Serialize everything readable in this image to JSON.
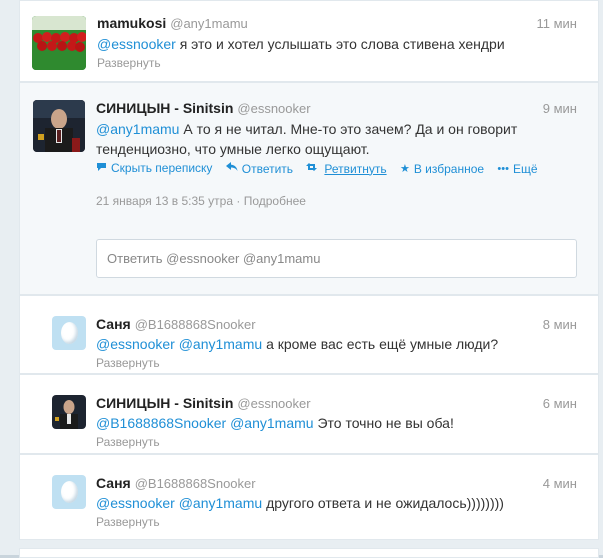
{
  "tweets": [
    {
      "fullname": "mamukosi",
      "username": "@any1mamu",
      "time": "11 мин",
      "mentions": [
        "@essnooker"
      ],
      "text": "я это и хотел услышать это слова стивена хендри",
      "expand": "Развернуть"
    },
    {
      "fullname": "СИНИЦЫН - Sinitsin",
      "username": "@essnooker",
      "time": "9 мин",
      "mentions": [
        "@any1mamu"
      ],
      "text_line1": "А то я не читал. Мне-то это зачем? Да и он говорит",
      "text_line2": "тенденциозно, что умные легко ощущают.",
      "actions": {
        "hide": "Скрыть переписку",
        "reply": "Ответить",
        "retweet": "Ретвитнуть",
        "favorite": "В избранное",
        "more": "Ещё"
      },
      "timestamp": "21 января 13 в 5:35 утра",
      "source": "Подробнее",
      "reply_placeholder": "Ответить @essnooker @any1mamu"
    },
    {
      "fullname": "Саня",
      "username": "@B1688868Snooker",
      "time": "8 мин",
      "mentions": [
        "@essnooker",
        "@any1mamu"
      ],
      "text": "а кроме вас есть ещё умные люди?",
      "expand": "Развернуть"
    },
    {
      "fullname": "СИНИЦЫН - Sinitsin",
      "username": "@essnooker",
      "time": "6 мин",
      "mentions": [
        "@B1688868Snooker",
        "@any1mamu"
      ],
      "text": "Это точно не вы оба!",
      "expand": "Развернуть"
    },
    {
      "fullname": "Саня",
      "username": "@B1688868Snooker",
      "time": "4 мин",
      "mentions": [
        "@essnooker",
        "@any1mamu"
      ],
      "text": "другого ответа и не ожидалось))))))))",
      "expand": "Развернуть"
    }
  ],
  "colors": {
    "link": "#1f8fd6",
    "muted": "#999999"
  },
  "icons": {
    "hide": "speech-bubble-icon",
    "reply": "reply-arrow-icon",
    "retweet": "retweet-icon",
    "favorite": "star-icon",
    "more": "ellipsis-icon"
  }
}
